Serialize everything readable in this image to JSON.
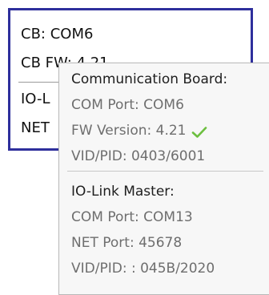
{
  "status": {
    "line1": "CB: COM6",
    "line2": "CB FW: 4.21",
    "line3": "IO-L",
    "line4": "NET"
  },
  "tooltip": {
    "section1": {
      "heading": "Communication Board:",
      "com_port": "COM Port: COM6",
      "fw_version": "FW Version: 4.21",
      "vid_pid": "VID/PID: 0403/6001"
    },
    "section2": {
      "heading": "IO-Link Master:",
      "com_port": "COM Port: COM13",
      "net_port": "NET Port: 45678",
      "vid_pid": "VID/PID: : 045B/2020"
    }
  },
  "icons": {
    "fw_ok": "check-icon"
  },
  "colors": {
    "border_accent": "#2e2f9c",
    "check_green": "#6cbf3f"
  }
}
